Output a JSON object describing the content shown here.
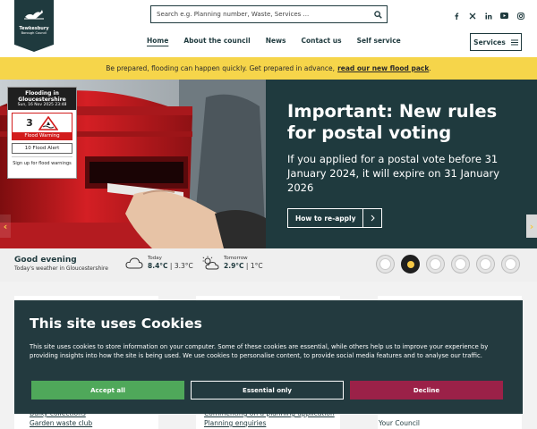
{
  "header": {
    "logo_title": "Tewkesbury",
    "logo_subtitle": "Borough Council",
    "search_placeholder": "Search e.g. Planning number, Waste, Services ...",
    "social": [
      "facebook-icon",
      "x-icon",
      "linkedin-icon",
      "youtube-icon",
      "instagram-icon"
    ],
    "nav": [
      "Home",
      "About the council",
      "News",
      "Contact us",
      "Self service"
    ],
    "services_label": "Services"
  },
  "banner": {
    "text": "Be prepared, flooding can happen quickly. Get prepared in advance,",
    "link": "read our new flood pack",
    "end": "."
  },
  "flood_widget": {
    "title": "Flooding in Gloucestershire",
    "timestamp": "Sun, 16 Nov 2025 23:48",
    "warning_count": "3",
    "warning_label": "Flood Warning",
    "alert_label": "10 Flood Alert",
    "signup": "Sign up for flood warnings"
  },
  "hero": {
    "title": "Important: New rules for postal voting",
    "body": "If you applied for a postal vote before 31 January 2024, it will expire on 31 January 2026",
    "button": "How to re-apply"
  },
  "weather": {
    "greeting": "Good evening",
    "subtitle": "Today's weather in Gloucestershire",
    "today_label": "Today",
    "today_high": "8.4°C",
    "today_low": "3.3°C",
    "tomorrow_label": "Tomorrow",
    "tomorrow_high": "2.9°C",
    "tomorrow_low": "1°C"
  },
  "carousel": {
    "slides": 6,
    "active_index": 1
  },
  "lower_links": {
    "col1": [
      "Bulky collections",
      "Garden waste club"
    ],
    "col2": [
      "Commenting on a planning application",
      "Planning enquiries"
    ],
    "col3": [
      "Your Council"
    ]
  },
  "cookie": {
    "title": "This site uses Cookies",
    "text": "This site uses cookies to store information on your computer. Some of these cookies are essential, while others help us to improve your experience by providing insights into how the site is being used. We use cookies to personalise content, to provide social media features and to analyse our traffic.",
    "accept": "Accept all",
    "essential": "Essential only",
    "decline": "Decline"
  },
  "colors": {
    "primary": "#1f3a3e",
    "banner": "#f6d54a",
    "accept": "#4fa85a",
    "decline": "#9b2148",
    "accent": "#f6c846"
  }
}
